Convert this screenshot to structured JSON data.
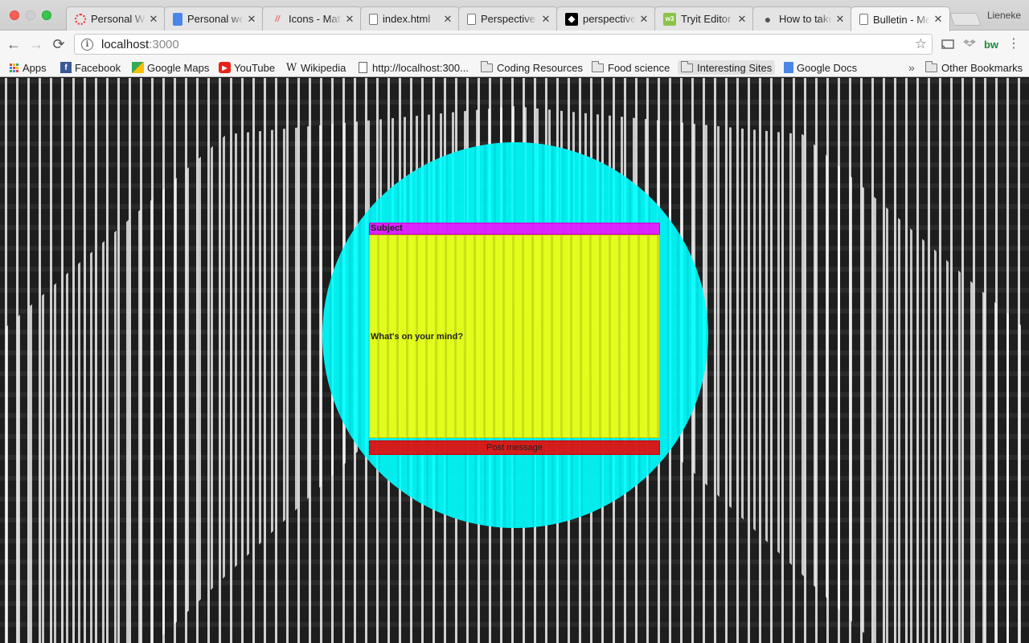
{
  "window": {
    "profile": "Lieneke",
    "tabs": [
      {
        "title": "Personal We",
        "icon": "opera-icon",
        "active": false
      },
      {
        "title": "Personal we",
        "icon": "google-docs-icon",
        "active": false
      },
      {
        "title": "Icons - Mate",
        "icon": "materialize-icon",
        "active": false
      },
      {
        "title": "index.html",
        "icon": "document-icon",
        "active": false
      },
      {
        "title": "Perspective",
        "icon": "document-icon",
        "active": false
      },
      {
        "title": "perspective",
        "icon": "github-icon",
        "active": false
      },
      {
        "title": "Tryit Editor",
        "icon": "w3schools-icon",
        "active": false
      },
      {
        "title": "How to take",
        "icon": "apple-icon",
        "active": false
      },
      {
        "title": "Bulletin - Me",
        "icon": "document-icon",
        "active": true
      }
    ],
    "close_glyph": "✕"
  },
  "toolbar": {
    "url_host": "localhost",
    "url_port": ":3000",
    "back_icon": "←",
    "forward_icon": "→",
    "reload_icon": "⟳",
    "star_icon": "☆",
    "info_icon": "i",
    "extensions": [
      "cast-icon",
      "dropbox-icon",
      "bw-icon",
      "menu-icon"
    ],
    "bw_label": "bw"
  },
  "bookmarks": {
    "items": [
      {
        "label": "Apps",
        "icon": "apps-icon"
      },
      {
        "label": "Facebook",
        "icon": "facebook-icon"
      },
      {
        "label": "Google Maps",
        "icon": "google-maps-icon"
      },
      {
        "label": "YouTube",
        "icon": "youtube-icon"
      },
      {
        "label": "Wikipedia",
        "icon": "wikipedia-icon"
      },
      {
        "label": "http://localhost:300...",
        "icon": "document-icon"
      },
      {
        "label": "Coding Resources",
        "icon": "folder-icon"
      },
      {
        "label": "Food science",
        "icon": "folder-icon"
      },
      {
        "label": "Interesting Sites",
        "icon": "folder-icon"
      },
      {
        "label": "Google Docs",
        "icon": "google-docs-icon"
      }
    ],
    "overflow_label": "»",
    "other_label": "Other Bookmarks"
  },
  "page": {
    "subject_placeholder": "Subject",
    "message_placeholder": "What's on your mind?",
    "post_button": "Post message"
  },
  "colors": {
    "circle": "#00ffff",
    "subject": "#ff00ff",
    "message": "#ffff00",
    "button": "#f00000"
  }
}
